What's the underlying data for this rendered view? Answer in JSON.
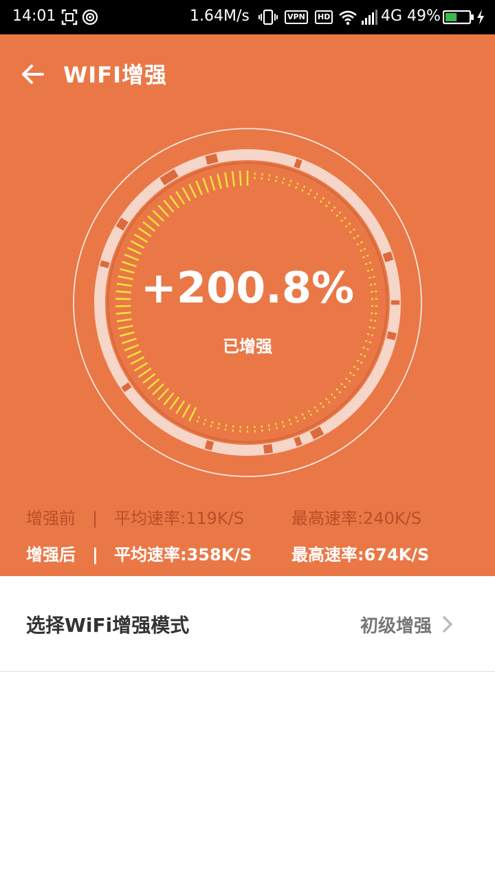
{
  "status_bar": {
    "time": "14:01",
    "speed": "1.64M/s",
    "vpn": "VPN",
    "hd": "HD",
    "network": "4G",
    "battery": "49%",
    "battery_level": 0.49,
    "icons": [
      "screenshot-icon",
      "hotspot-icon",
      "vibrate-icon",
      "wifi-icon",
      "signal-icon",
      "battery-icon",
      "charging-icon"
    ]
  },
  "header": {
    "title": "WIFI增强",
    "back_icon": "back-arrow-icon",
    "background_color": "#EA7847"
  },
  "gauge": {
    "value": "+200.8%",
    "label": "已增强",
    "progress": 0.0,
    "tick_color": "#F7E83A"
  },
  "stats": {
    "before": {
      "label": "增强前",
      "separator": "|",
      "avg": "平均速率:119K/S",
      "max": "最高速率:240K/S"
    },
    "after": {
      "label": "增强后",
      "separator": "|",
      "avg": "平均速率:358K/S",
      "max": "最高速率:674K/S"
    }
  },
  "mode": {
    "label": "选择WiFi增强模式",
    "value": "初级增强",
    "chevron_icon": "chevron-right-icon"
  }
}
